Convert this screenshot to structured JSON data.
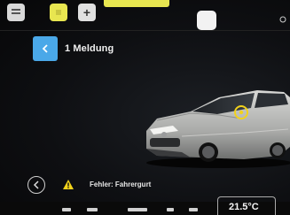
{
  "header": {
    "title": "1 Meldung"
  },
  "warning": {
    "text": "Fehler: Fahrergurt"
  },
  "status": {
    "temperature": "21.5°C"
  },
  "topbar": {
    "add_label": "+"
  },
  "colors": {
    "accent_yellow": "#e8e650",
    "back_button_blue": "#4aa8e8",
    "warning_yellow": "#f2d21b"
  },
  "icons": {
    "home": "home-icon",
    "favorite": "star-icon",
    "add": "plus-icon",
    "profile": "profile-icon",
    "back": "chevron-left-icon",
    "warning": "warning-triangle-icon"
  }
}
